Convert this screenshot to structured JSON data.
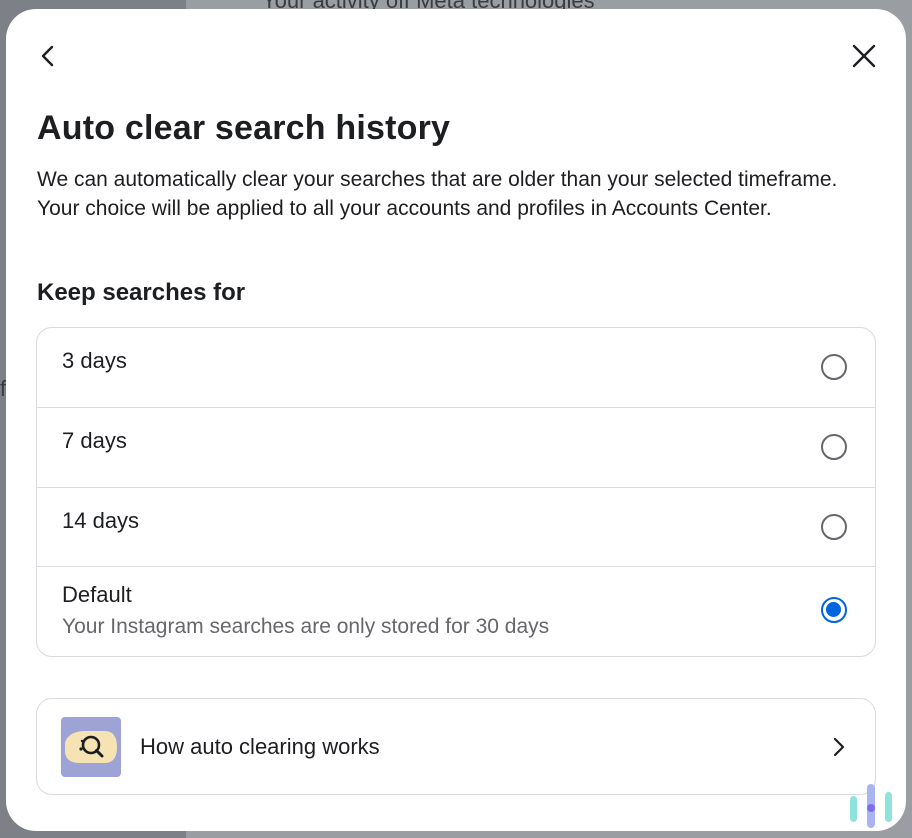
{
  "background": {
    "partial_heading": "Your activity off Meta technologies",
    "partial_letter": "f"
  },
  "modal": {
    "back_icon": "chevron-left-icon",
    "close_icon": "close-icon",
    "title": "Auto clear search history",
    "description": "We can automatically clear your searches that are older than your selected timeframe. Your choice will be applied to all your accounts and profiles in Accounts Center.",
    "section_label": "Keep searches for",
    "options": [
      {
        "label": "3 days",
        "sublabel": "",
        "selected": false
      },
      {
        "label": "7 days",
        "sublabel": "",
        "selected": false
      },
      {
        "label": "14 days",
        "sublabel": "",
        "selected": false
      },
      {
        "label": "Default",
        "sublabel": "Your Instagram searches are only stored for 30 days",
        "selected": true
      }
    ],
    "info_card": {
      "label": "How auto clearing works",
      "thumbnail_icon": "magnifier-illustration-icon",
      "chevron_icon": "chevron-right-icon"
    }
  },
  "colors": {
    "accent": "#0064e0",
    "text_primary": "#1c1e21",
    "text_secondary": "#65676b",
    "border": "#d9dbdf"
  }
}
